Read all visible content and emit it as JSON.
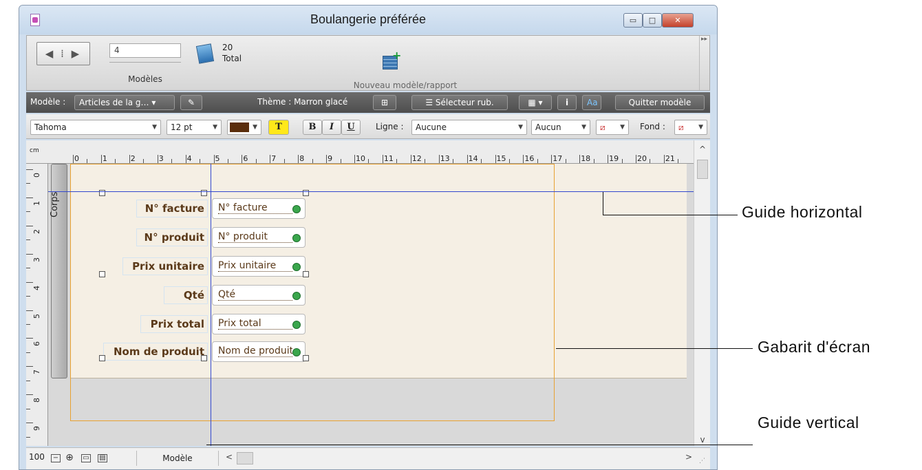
{
  "window": {
    "title": "Boulangerie préférée",
    "min_glyph": "▭",
    "max_glyph": "□",
    "close_glyph": "✕"
  },
  "status_toolbar": {
    "record_value": "4",
    "records_label": "Modèles",
    "total_count": "20",
    "total_label": "Total",
    "new_layout_label": "Nouveau modèle/rapport"
  },
  "layout_bar": {
    "layout_label": "Modèle :",
    "layout_name": "Articles de la g…",
    "theme_text": "Thème : Marron glacé",
    "field_picker_label": "Sélecteur rub.",
    "info_glyph": "i",
    "aa_glyph": "Aa",
    "exit_label": "Quitter modèle"
  },
  "format_bar": {
    "font_name": "Tahoma",
    "font_size": "12 pt",
    "text_color": "#5a2d0c",
    "highlight_glyph": "T",
    "bold_glyph": "B",
    "italic_glyph": "I",
    "underline_glyph": "U",
    "line_label": "Ligne :",
    "line_value": "Aucune",
    "line_width_value": "Aucun",
    "fill_label": "Fond :"
  },
  "ruler": {
    "unit": "cm",
    "h_numbers": [
      "0",
      "1",
      "2",
      "3",
      "4",
      "5",
      "6",
      "7",
      "8",
      "9",
      "10",
      "11",
      "12",
      "13",
      "14",
      "15",
      "16",
      "17",
      "18",
      "19",
      "20",
      "21"
    ],
    "v_numbers": [
      "0",
      "1",
      "2",
      "3",
      "4",
      "5",
      "6",
      "7",
      "8",
      "9"
    ]
  },
  "layout_part": {
    "name": "Corps"
  },
  "fields": [
    {
      "label": "N° facture",
      "value": "N° facture"
    },
    {
      "label": "N° produit",
      "value": "N° produit"
    },
    {
      "label": "Prix unitaire",
      "value": "Prix unitaire"
    },
    {
      "label": "Qté",
      "value": "Qté"
    },
    {
      "label": "Prix total",
      "value": "Prix total"
    },
    {
      "label": "Nom de produit",
      "value": "Nom de produit"
    }
  ],
  "bottom_bar": {
    "zoom": "100",
    "mode": "Modèle"
  },
  "callouts": {
    "horizontal_guide": "Guide horizontal",
    "screen_stencil": "Gabarit d'écran",
    "vertical_guide": "Guide vertical"
  },
  "colors": {
    "guide": "#3248ce",
    "stencil": "#e8a130",
    "label_text": "#5b3a1a",
    "body_background": "#f5efe4"
  }
}
